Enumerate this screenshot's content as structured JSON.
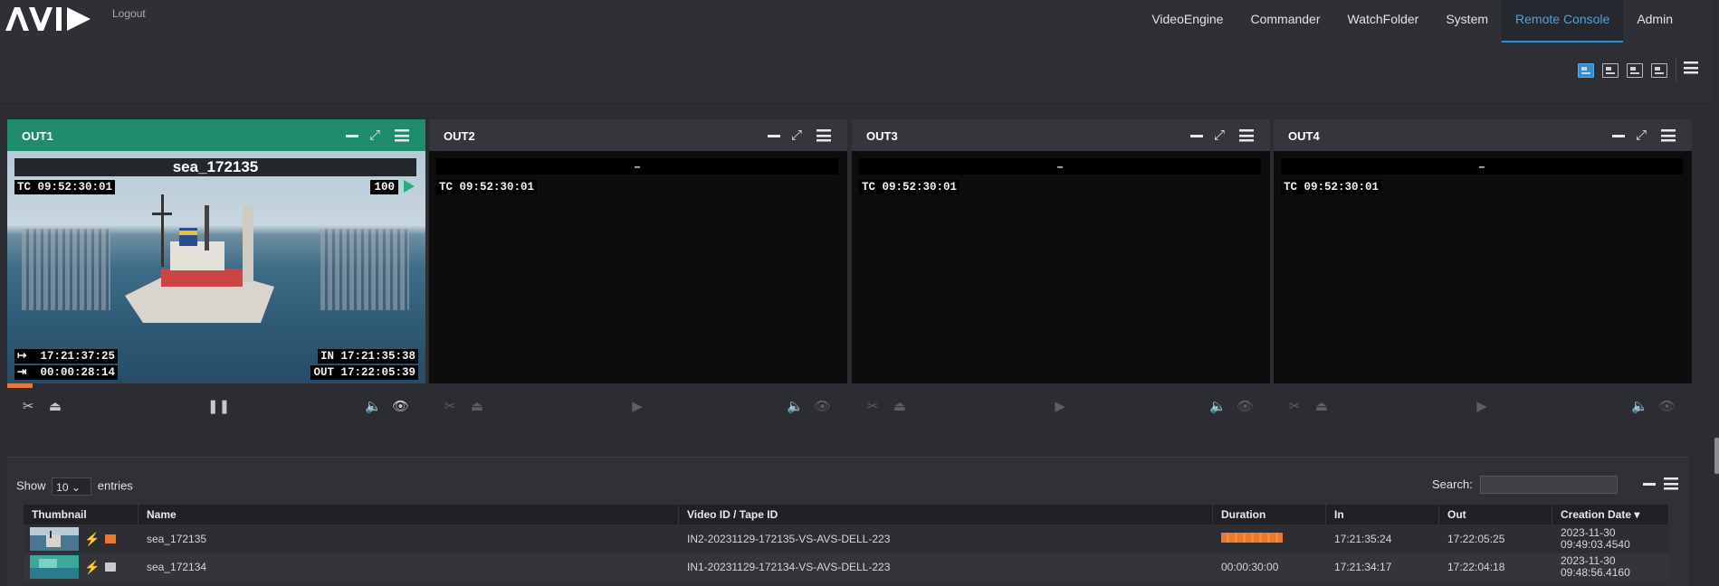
{
  "nav": {
    "logout": "Logout",
    "items": [
      "VideoEngine",
      "Commander",
      "WatchFolder",
      "System",
      "Remote Console",
      "Admin"
    ],
    "active": "Remote Console"
  },
  "players": [
    {
      "title": "OUT1",
      "active": true,
      "clip_name": "sea_172135",
      "tc": "TC 09:52:30:01",
      "speed": "100",
      "elapsed_icon": "↦",
      "elapsed": "17:21:37:25",
      "remaining_icon": "⇥",
      "remaining": "00:00:28:14",
      "in": "IN 17:21:35:38",
      "out": "OUT 17:22:05:39",
      "progress": 0.06
    },
    {
      "title": "OUT2",
      "active": false,
      "clip_name": "–",
      "tc": "TC 09:52:30:01"
    },
    {
      "title": "OUT3",
      "active": false,
      "clip_name": "–",
      "tc": "TC 09:52:30:01"
    },
    {
      "title": "OUT4",
      "active": false,
      "clip_name": "–",
      "tc": "TC 09:52:30:01"
    }
  ],
  "table": {
    "show_label": "Show",
    "page_size": "10",
    "entries_label": "entries",
    "search_label": "Search:",
    "columns": [
      "Thumbnail",
      "Name",
      "Video ID / Tape ID",
      "Duration",
      "In",
      "Out",
      "Creation Date"
    ],
    "rows": [
      {
        "name": "sea_172135",
        "video_id": "IN2-20231129-172135-VS-AVS-DELL-223",
        "duration": "",
        "in": "17:21:35:24",
        "out": "17:22:05:25",
        "date": "2023-11-30",
        "time": "09:49:03.4540",
        "locked": true,
        "recording": true
      },
      {
        "name": "sea_172134",
        "video_id": "IN1-20231129-172134-VS-AVS-DELL-223",
        "duration": "00:00:30:00",
        "in": "17:21:34:17",
        "out": "17:22:04:18",
        "date": "2023-11-30",
        "time": "09:48:56.4160",
        "locked": false,
        "recording": false
      }
    ]
  },
  "colors": {
    "accent": "#2a8fd9",
    "active_player": "#1f8c6c",
    "recording": "#e8792f",
    "lock_active": "#e8792f"
  }
}
